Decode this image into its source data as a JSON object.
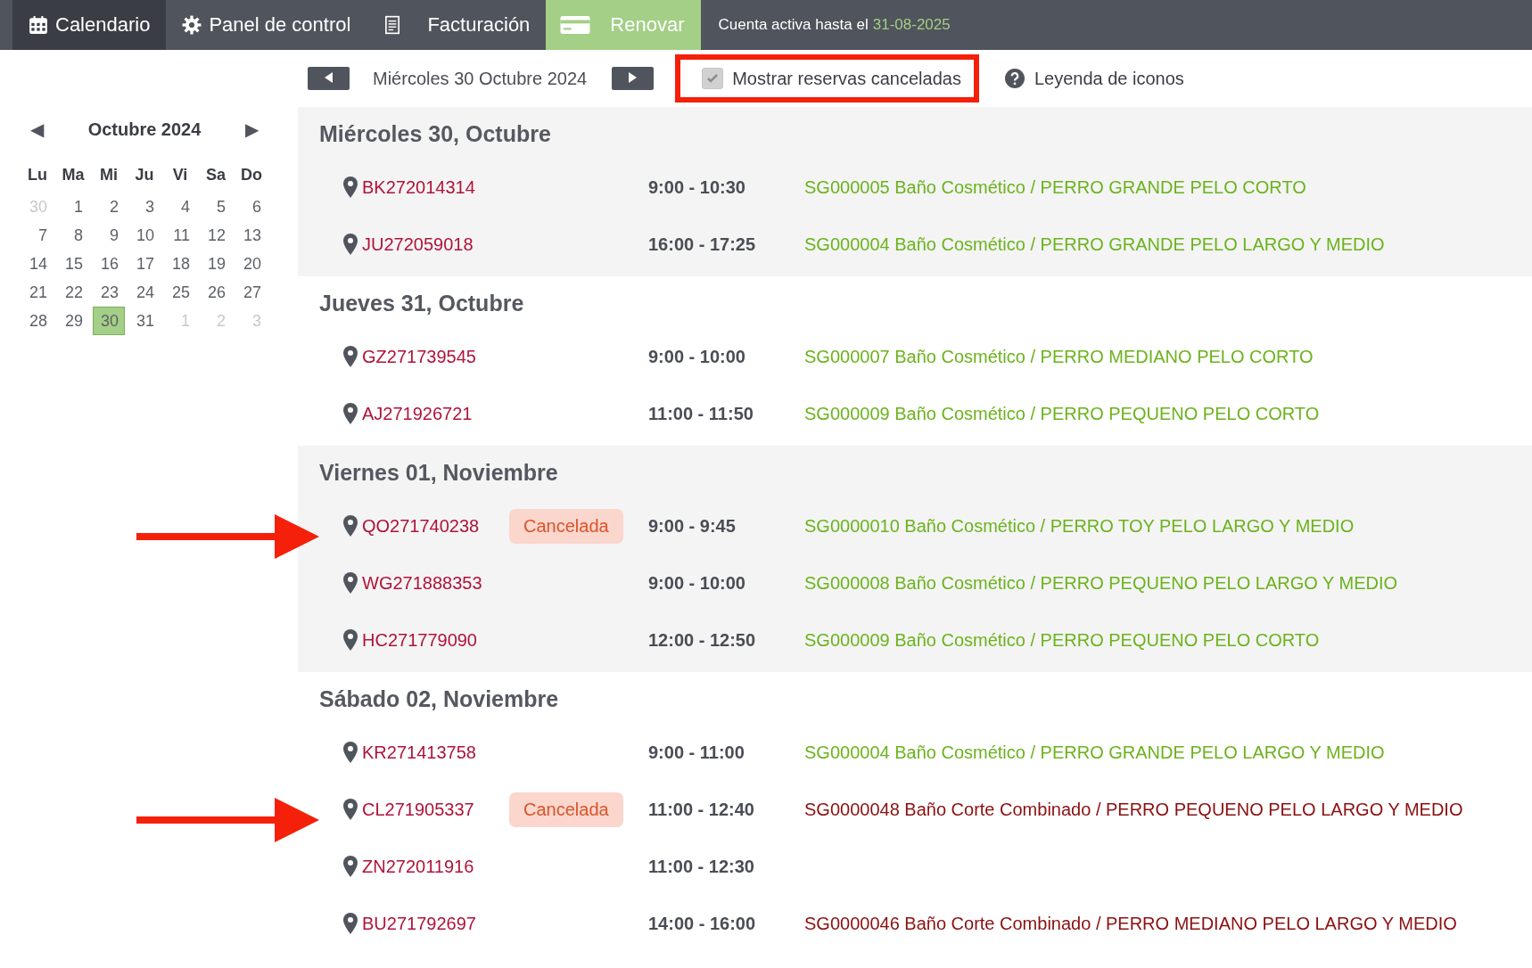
{
  "top_nav": {
    "items": [
      {
        "label": "Calendario",
        "kind": "calendar",
        "selected": true
      },
      {
        "label": "Panel de control",
        "kind": "gear",
        "selected": false
      },
      {
        "label": "Facturación",
        "kind": "invoice",
        "selected": false
      },
      {
        "label": "Renovar",
        "kind": "renew",
        "selected": false
      }
    ],
    "account": {
      "text": "Cuenta activa hasta el",
      "date": "31-08-2025"
    }
  },
  "mini_calendar": {
    "title": "Octubre 2024",
    "prev": "◀",
    "next": "▶",
    "weekdays": [
      "Lu",
      "Ma",
      "Mi",
      "Ju",
      "Vi",
      "Sa",
      "Do"
    ],
    "weeks": [
      [
        {
          "day": "30",
          "muted": true,
          "selected": false
        },
        {
          "day": "1",
          "muted": false,
          "selected": false
        },
        {
          "day": "2",
          "muted": false,
          "selected": false
        },
        {
          "day": "3",
          "muted": false,
          "selected": false
        },
        {
          "day": "4",
          "muted": false,
          "selected": false
        },
        {
          "day": "5",
          "muted": false,
          "selected": false
        },
        {
          "day": "6",
          "muted": false,
          "selected": false
        }
      ],
      [
        {
          "day": "7",
          "muted": false,
          "selected": false
        },
        {
          "day": "8",
          "muted": false,
          "selected": false
        },
        {
          "day": "9",
          "muted": false,
          "selected": false
        },
        {
          "day": "10",
          "muted": false,
          "selected": false
        },
        {
          "day": "11",
          "muted": false,
          "selected": false
        },
        {
          "day": "12",
          "muted": false,
          "selected": false
        },
        {
          "day": "13",
          "muted": false,
          "selected": false
        }
      ],
      [
        {
          "day": "14",
          "muted": false,
          "selected": false
        },
        {
          "day": "15",
          "muted": false,
          "selected": false
        },
        {
          "day": "16",
          "muted": false,
          "selected": false
        },
        {
          "day": "17",
          "muted": false,
          "selected": false
        },
        {
          "day": "18",
          "muted": false,
          "selected": false
        },
        {
          "day": "19",
          "muted": false,
          "selected": false
        },
        {
          "day": "20",
          "muted": false,
          "selected": false
        }
      ],
      [
        {
          "day": "21",
          "muted": false,
          "selected": false
        },
        {
          "day": "22",
          "muted": false,
          "selected": false
        },
        {
          "day": "23",
          "muted": false,
          "selected": false
        },
        {
          "day": "24",
          "muted": false,
          "selected": false
        },
        {
          "day": "25",
          "muted": false,
          "selected": false
        },
        {
          "day": "26",
          "muted": false,
          "selected": false
        },
        {
          "day": "27",
          "muted": false,
          "selected": false
        }
      ],
      [
        {
          "day": "28",
          "muted": false,
          "selected": false
        },
        {
          "day": "29",
          "muted": false,
          "selected": false
        },
        {
          "day": "30",
          "muted": false,
          "selected": true
        },
        {
          "day": "31",
          "muted": false,
          "selected": false
        },
        {
          "day": "1",
          "muted": true,
          "selected": false
        },
        {
          "day": "2",
          "muted": true,
          "selected": false
        },
        {
          "day": "3",
          "muted": true,
          "selected": false
        }
      ]
    ]
  },
  "toolbar": {
    "date": "Miércoles 30 Octubre 2024",
    "show_cancelled": {
      "label": "Mostrar reservas canceladas",
      "checked": true,
      "disabled": true,
      "highlighted": true
    },
    "legend": "Leyenda de iconos"
  },
  "days": [
    {
      "title": "Miércoles 30, Octubre",
      "bookings": [
        {
          "code": "BK272014314",
          "time": "9:00 - 10:30",
          "service": "SG000005 Baño Cosmético / PERRO GRANDE PELO CORTO",
          "color": "#6bb31d",
          "highlighted": false
        },
        {
          "code": "JU272059018",
          "time": "16:00 - 17:25",
          "service": "SG000004 Baño Cosmético / PERRO GRANDE PELO LARGO Y MEDIO",
          "color": "#6bb31d",
          "highlighted": false
        }
      ]
    },
    {
      "title": "Jueves 31, Octubre",
      "bookings": [
        {
          "code": "GZ271739545",
          "time": "9:00 - 10:00",
          "service": "SG000007 Baño Cosmético / PERRO MEDIANO PELO CORTO",
          "color": "#6bb31d",
          "highlighted": false
        },
        {
          "code": "AJ271926721",
          "time": "11:00 - 11:50",
          "service": "SG000009 Baño Cosmético / PERRO PEQUENO PELO CORTO",
          "color": "#6bb31d",
          "highlighted": false
        }
      ]
    },
    {
      "title": "Viernes 01, Noviembre",
      "bookings": [
        {
          "code": "QO271740238",
          "status": "Cancelada",
          "time": "9:00 - 9:45",
          "service": "SG0000010 Baño Cosmético / PERRO TOY PELO LARGO Y MEDIO",
          "color": "#6bb31d",
          "highlighted": true
        },
        {
          "code": "WG271888353",
          "time": "9:00 - 10:00",
          "service": "SG000008 Baño Cosmético / PERRO PEQUENO PELO LARGO Y MEDIO",
          "color": "#6bb31d",
          "highlighted": false
        },
        {
          "code": "HC271779090",
          "time": "12:00 - 12:50",
          "service": "SG000009 Baño Cosmético / PERRO PEQUENO PELO CORTO",
          "color": "#6bb31d",
          "highlighted": false
        }
      ]
    },
    {
      "title": "Sábado 02, Noviembre",
      "bookings": [
        {
          "code": "KR271413758",
          "time": "9:00 - 11:00",
          "service": "SG000004 Baño Cosmético / PERRO GRANDE PELO LARGO Y MEDIO",
          "color": "#6bb31d",
          "highlighted": false
        },
        {
          "code": "CL271905337",
          "status": "Cancelada",
          "time": "11:00 - 12:40",
          "service": "SG0000048 Baño Corte Combinado / PERRO PEQUENO PELO LARGO Y MEDIO",
          "color": "#8b1010",
          "highlighted": true
        },
        {
          "code": "ZN272011916",
          "time": "11:00 - 12:30",
          "highlighted": false
        },
        {
          "code": "BU271792697",
          "time": "14:00 - 16:00",
          "service": "SG0000046 Baño Corte Combinado / PERRO MEDIANO PELO LARGO Y MEDIO",
          "color": "#8b1010",
          "highlighted": false
        }
      ]
    }
  ]
}
